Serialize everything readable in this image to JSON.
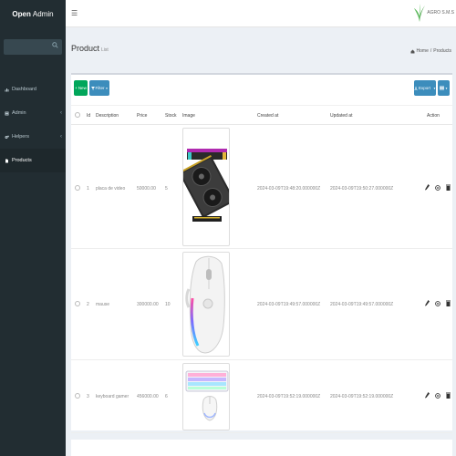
{
  "app": {
    "logo_bold": "Open",
    "logo_rest": "Admin",
    "brand": "AGRO S.M.S"
  },
  "sidebar": {
    "items": [
      {
        "label": "Dashboard",
        "icon": "bar-chart-icon"
      },
      {
        "label": "Admin",
        "icon": "tasks-icon"
      },
      {
        "label": "Helpers",
        "icon": "gears-icon"
      },
      {
        "label": "Products",
        "icon": "file-icon"
      }
    ]
  },
  "page": {
    "title": "Product",
    "subtitle": "List",
    "crumb_home": "Home",
    "crumb_current": "Products"
  },
  "toolbar": {
    "new": "New",
    "filter": "Filter",
    "export": "Export"
  },
  "table": {
    "headers": [
      "Id",
      "Description",
      "Price",
      "Stock",
      "Image",
      "Created at",
      "Updated at",
      "Action"
    ],
    "rows": [
      {
        "id": "1",
        "description": "placa de video",
        "price": "50000.00",
        "stock": "5",
        "created": "2024-03-09T19:48:20.000000Z",
        "updated": "2024-03-09T19:50:27.000000Z",
        "image": "graphics-card"
      },
      {
        "id": "2",
        "description": "mause",
        "price": "300000.00",
        "stock": "10",
        "created": "2024-03-09T19:49:57.000000Z",
        "updated": "2024-03-09T19:49:57.000000Z",
        "image": "gaming-mouse"
      },
      {
        "id": "3",
        "description": "keyboard gamer",
        "price": "456000.00",
        "stock": "6",
        "created": "2024-03-09T19:52:19.000000Z",
        "updated": "2024-03-09T19:52:19.000000Z",
        "image": "keyboard-mouse"
      }
    ]
  }
}
